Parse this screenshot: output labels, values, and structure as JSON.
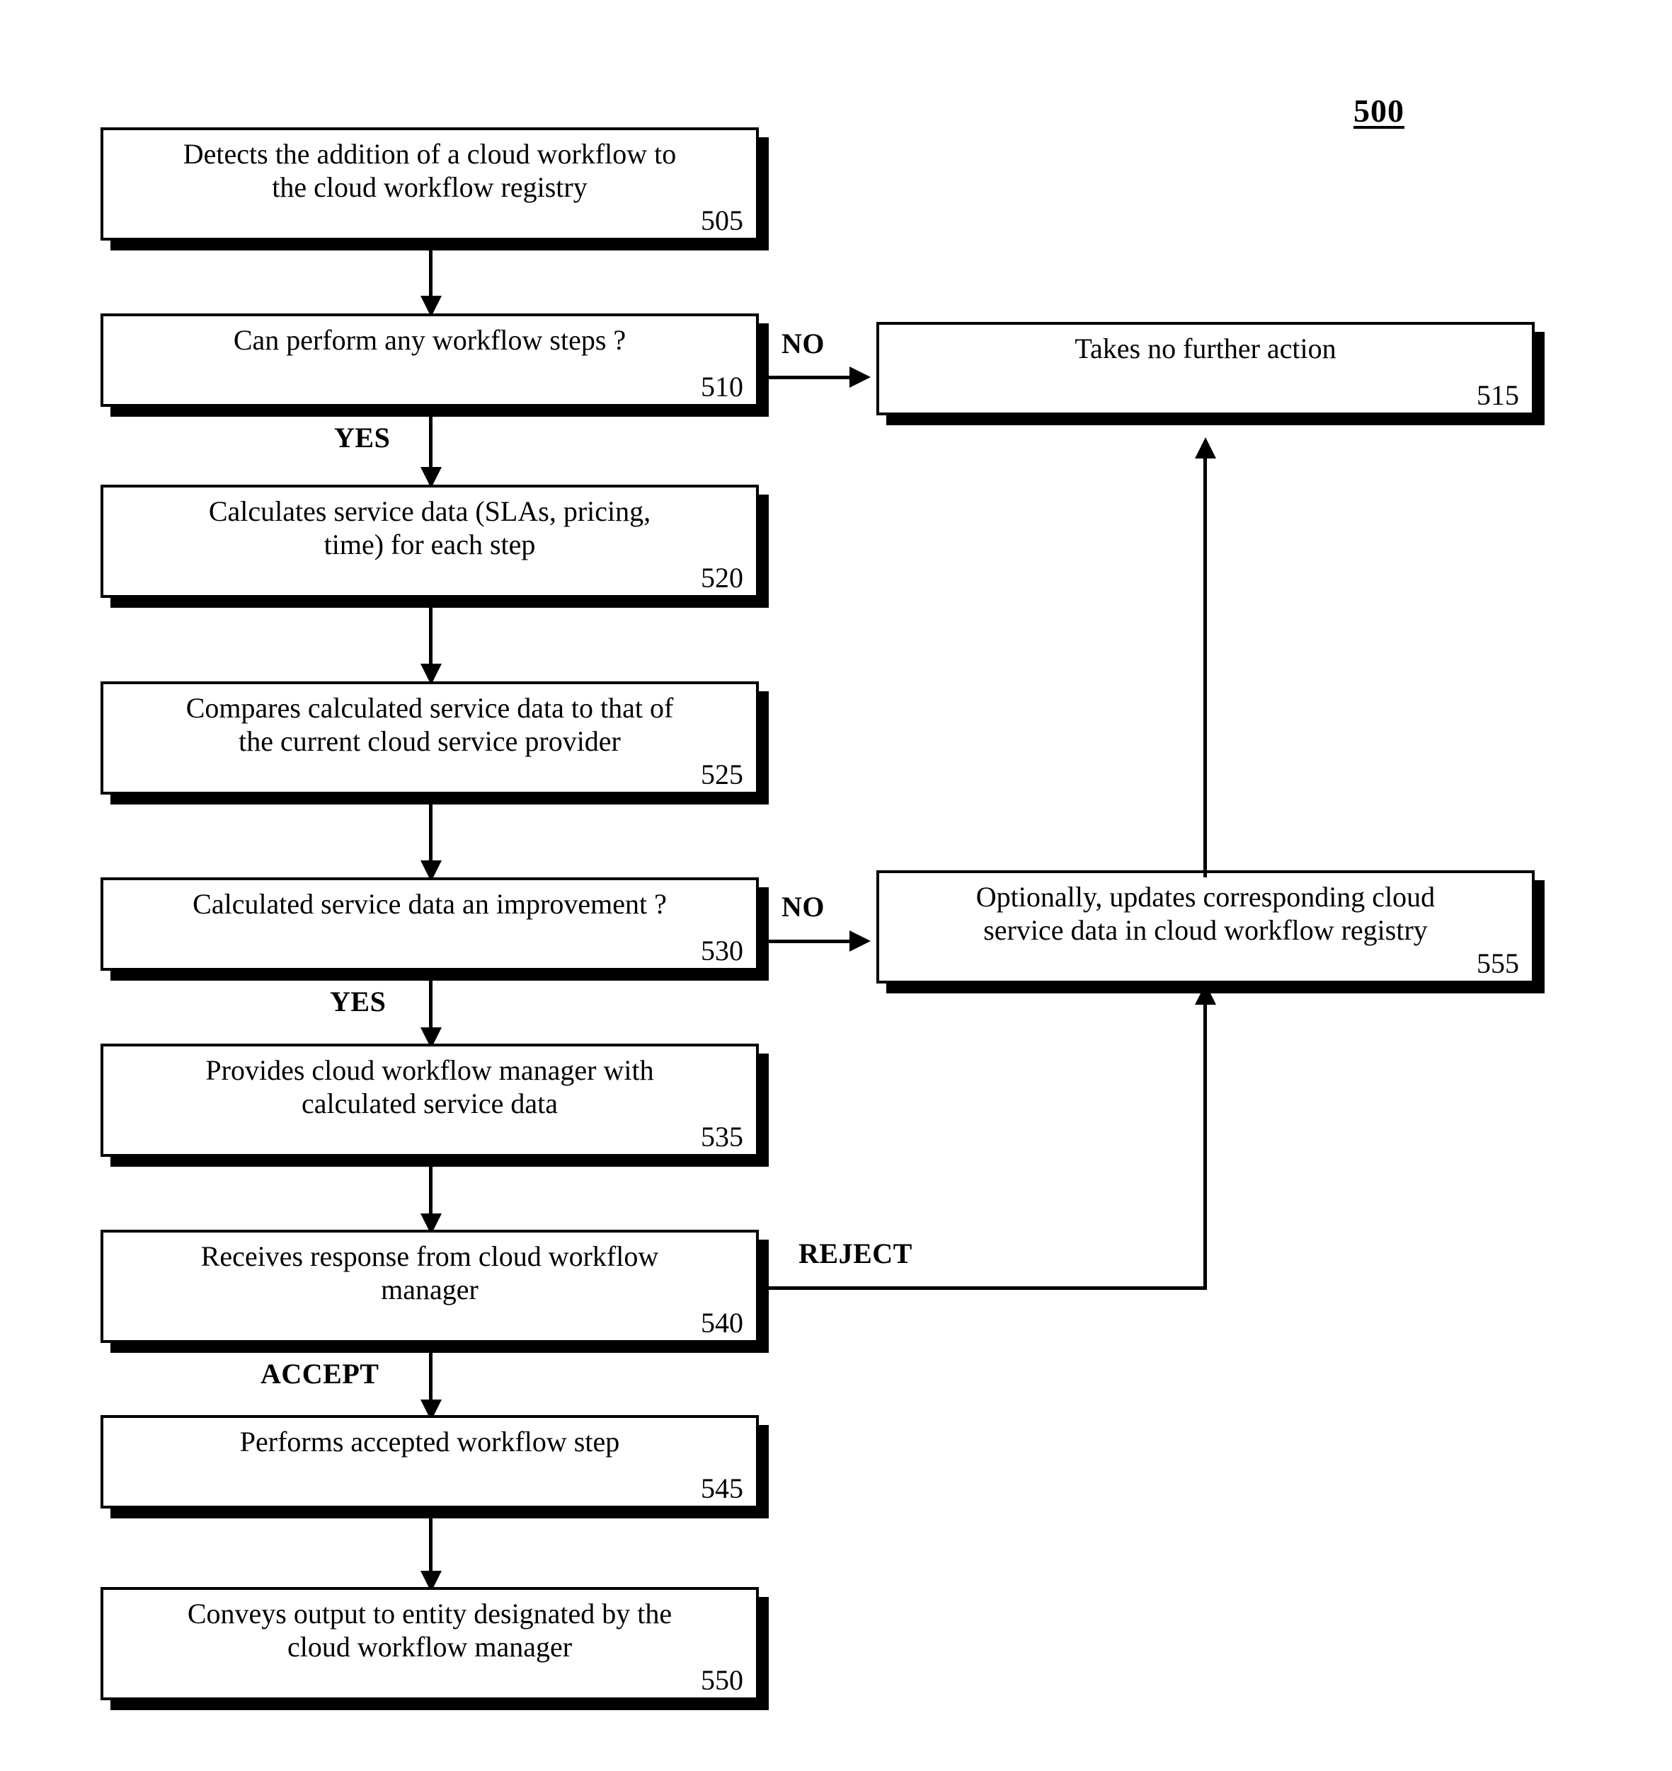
{
  "figure": {
    "number": "500"
  },
  "nodes": [
    {
      "id": "n505",
      "text": "Detects the addition of a cloud workflow to\nthe cloud workflow registry",
      "ref": "505"
    },
    {
      "id": "n510",
      "text": "Can perform any workflow steps ?",
      "ref": "510"
    },
    {
      "id": "n515",
      "text": "Takes no further action",
      "ref": "515"
    },
    {
      "id": "n520",
      "text": "Calculates service data (SLAs, pricing,\ntime) for each step",
      "ref": "520"
    },
    {
      "id": "n525",
      "text": "Compares calculated service data to that of\nthe current cloud service provider",
      "ref": "525"
    },
    {
      "id": "n530",
      "text": "Calculated service data an improvement ?",
      "ref": "530"
    },
    {
      "id": "n555",
      "text": "Optionally, updates corresponding cloud\nservice data in cloud workflow registry",
      "ref": "555"
    },
    {
      "id": "n535",
      "text": "Provides cloud workflow manager with\ncalculated service data",
      "ref": "535"
    },
    {
      "id": "n540",
      "text": "Receives response from cloud workflow\nmanager",
      "ref": "540"
    },
    {
      "id": "n545",
      "text": "Performs accepted workflow step",
      "ref": "545"
    },
    {
      "id": "n550",
      "text": "Conveys output to entity designated by the\ncloud workflow manager",
      "ref": "550"
    }
  ],
  "edge_labels": {
    "no_510": "NO",
    "yes_510": "YES",
    "no_530": "NO",
    "yes_530": "YES",
    "reject_540": "REJECT",
    "accept_540": "ACCEPT"
  },
  "chart_data": {
    "type": "diagram",
    "title": "500",
    "diagram_kind": "flowchart",
    "nodes": [
      {
        "ref": "505",
        "label": "Detects the addition of a cloud workflow to the cloud workflow registry",
        "shape": "rect",
        "column": "left"
      },
      {
        "ref": "510",
        "label": "Can perform any workflow steps ?",
        "shape": "rect-decision",
        "column": "left"
      },
      {
        "ref": "515",
        "label": "Takes no further action",
        "shape": "rect",
        "column": "right"
      },
      {
        "ref": "520",
        "label": "Calculates service data (SLAs, pricing, time) for each step",
        "shape": "rect",
        "column": "left"
      },
      {
        "ref": "525",
        "label": "Compares calculated service data to that of the current cloud service provider",
        "shape": "rect",
        "column": "left"
      },
      {
        "ref": "530",
        "label": "Calculated service data an improvement ?",
        "shape": "rect-decision",
        "column": "left"
      },
      {
        "ref": "555",
        "label": "Optionally, updates corresponding cloud service data in cloud workflow registry",
        "shape": "rect",
        "column": "right"
      },
      {
        "ref": "535",
        "label": "Provides cloud workflow manager with calculated service data",
        "shape": "rect",
        "column": "left"
      },
      {
        "ref": "540",
        "label": "Receives response from cloud workflow manager",
        "shape": "rect-decision",
        "column": "left"
      },
      {
        "ref": "545",
        "label": "Performs accepted workflow step",
        "shape": "rect",
        "column": "left"
      },
      {
        "ref": "550",
        "label": "Conveys output to entity designated by the cloud workflow manager",
        "shape": "rect",
        "column": "left"
      }
    ],
    "edges": [
      {
        "from": "505",
        "to": "510",
        "label": ""
      },
      {
        "from": "510",
        "to": "515",
        "label": "NO"
      },
      {
        "from": "510",
        "to": "520",
        "label": "YES"
      },
      {
        "from": "520",
        "to": "525",
        "label": ""
      },
      {
        "from": "525",
        "to": "530",
        "label": ""
      },
      {
        "from": "530",
        "to": "555",
        "label": "NO"
      },
      {
        "from": "530",
        "to": "535",
        "label": "YES"
      },
      {
        "from": "535",
        "to": "540",
        "label": ""
      },
      {
        "from": "540",
        "to": "555",
        "label": "REJECT"
      },
      {
        "from": "540",
        "to": "545",
        "label": "ACCEPT"
      },
      {
        "from": "545",
        "to": "550",
        "label": ""
      },
      {
        "from": "555",
        "to": "515",
        "label": ""
      }
    ]
  }
}
